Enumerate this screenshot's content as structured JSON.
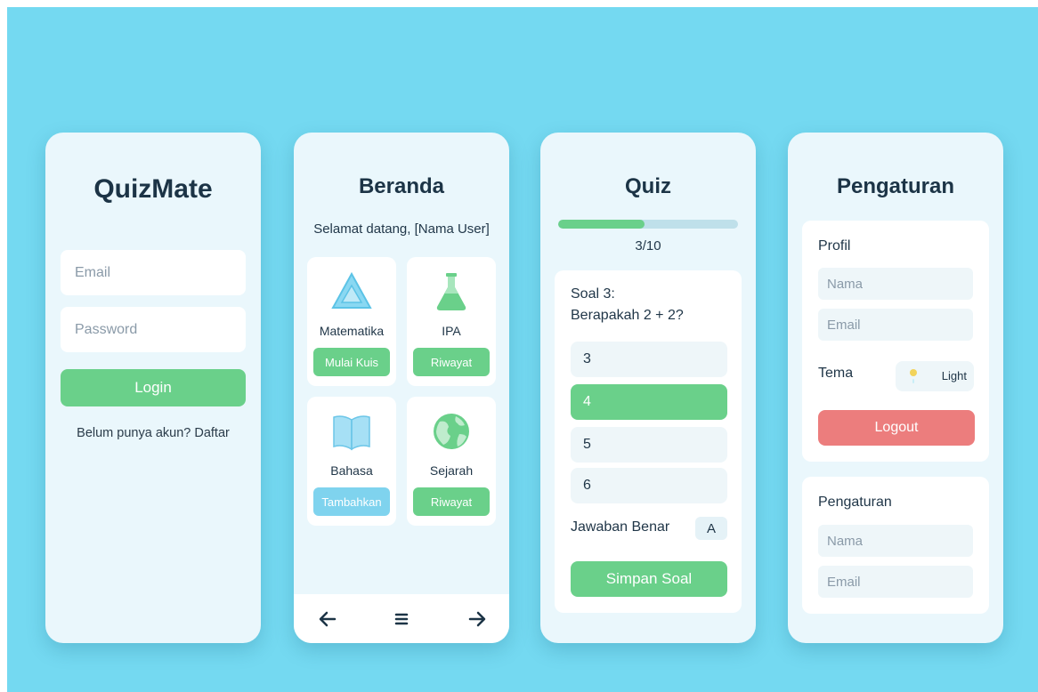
{
  "colors": {
    "background": "#74d9f1",
    "screen": "#eaf7fc",
    "accent_green": "#6ad08a",
    "accent_blue": "#7fd3ee",
    "danger": "#ec7d7d",
    "text_dark": "#1c3446"
  },
  "login": {
    "title": "QuizMate",
    "email_placeholder": "Email",
    "password_placeholder": "Password",
    "login_label": "Login",
    "register_prompt": "Belum punya akun? Daftar"
  },
  "home": {
    "title": "Beranda",
    "greeting": "Selamat datang, [Nama User]",
    "categories": [
      {
        "name": "Matematika",
        "icon": "triangle-ruler-icon",
        "button": "Mulai Kuis"
      },
      {
        "name": "IPA",
        "icon": "flask-icon",
        "button": "Riwayat"
      },
      {
        "name": "Bahasa",
        "icon": "open-book-icon",
        "button": "Tambahkan"
      },
      {
        "name": "Sejarah",
        "icon": "globe-icon",
        "button": "Riwayat"
      }
    ],
    "nav": {
      "back_icon": "arrow-left-icon",
      "menu_icon": "hamburger-menu-icon",
      "forward_icon": "arrow-right-icon"
    }
  },
  "quiz": {
    "title": "Quiz",
    "progress": {
      "current": 3,
      "total": 10,
      "label": "3/10"
    },
    "question_number": "Soal 3:",
    "question_text": "Berapakah 2 + 2?",
    "options": [
      "3",
      "4",
      "5",
      "6"
    ],
    "selected_option": "4",
    "answer_label": "Jawaban Benar",
    "answer_value": "A",
    "save_label": "Simpan Soal"
  },
  "settings": {
    "title": "Pengaturan",
    "profile": {
      "title": "Profil",
      "name_placeholder": "Nama",
      "email_placeholder": "Email",
      "theme_label": "Tema",
      "theme_value": "Light",
      "theme_icon": "sun-icon",
      "logout_label": "Logout"
    },
    "section2": {
      "title": "Pengaturan",
      "name_placeholder": "Nama",
      "email_placeholder": "Email"
    }
  }
}
